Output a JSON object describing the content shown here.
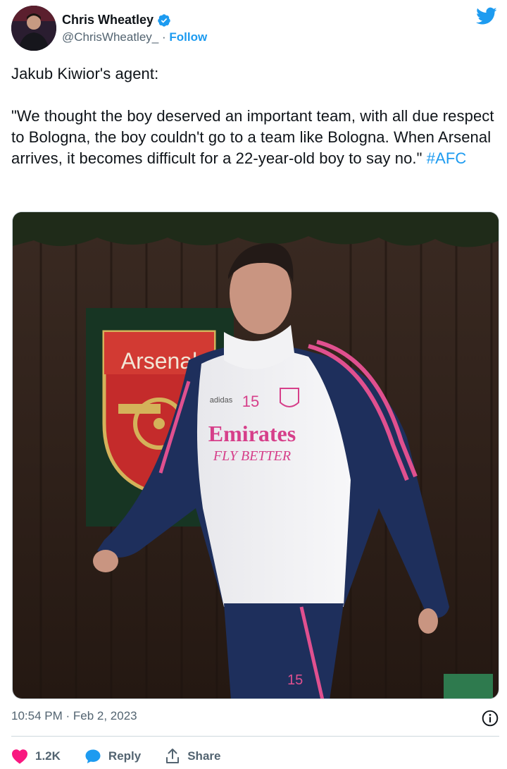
{
  "author": {
    "display_name": "Chris Wheatley",
    "handle": "@ChrisWheatley_",
    "separator": " · ",
    "follow_label": "Follow",
    "verified": true
  },
  "tweet": {
    "line1": "Jakub Kiwior's agent:",
    "quote": "\"We thought the boy deserved an important team, with all due respect to Bologna, the boy couldn't go to a team like Bologna. When Arsenal arrives, it becomes difficult for a 22-year-old boy to say no.\" ",
    "hashtag": "#AFC"
  },
  "media": {
    "crest_text": "Arsenal",
    "shirt_number": "15",
    "sponsor_line1": "Emirates",
    "sponsor_line2": "FLY BETTER",
    "brand": "adidas"
  },
  "meta": {
    "timestamp": "10:54 PM · Feb 2, 2023"
  },
  "actions": {
    "likes": "1.2K",
    "reply_label": "Reply",
    "share_label": "Share"
  },
  "colors": {
    "accent": "#1d9bf0",
    "like": "#f91880",
    "text": "#0f1419",
    "muted": "#536471"
  }
}
